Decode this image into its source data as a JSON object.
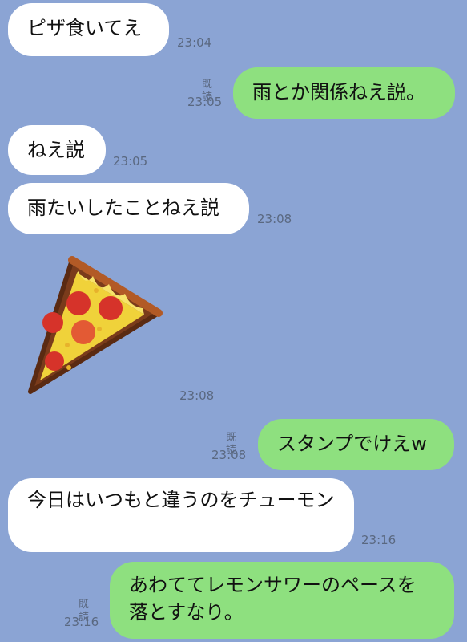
{
  "messages": [
    {
      "text": "ピザ食いてえ",
      "time": "23:04",
      "side": "in"
    },
    {
      "text": "雨とか関係ねえ説。",
      "time": "23:05",
      "read": "既読",
      "side": "out"
    },
    {
      "text": "ねえ説",
      "time": "23:05",
      "side": "in"
    },
    {
      "text": "雨たいしたことねえ説",
      "time": "23:08",
      "side": "in"
    },
    {
      "sticker": "pizza-slice-sticker",
      "time": "23:08",
      "side": "in"
    },
    {
      "text": "スタンプでけえw",
      "time": "23:08",
      "read": "既読",
      "side": "out"
    },
    {
      "text": "今日はいつもと違うのをチューモン",
      "time": "23:16",
      "side": "in"
    },
    {
      "text": "あわててレモンサワーのペースを落とすなり。",
      "time": "23:16",
      "read": "既読",
      "side": "out"
    }
  ],
  "colors": {
    "background": "#8ba4d4",
    "incoming_bubble": "#ffffff",
    "outgoing_bubble": "#8ee07f"
  }
}
